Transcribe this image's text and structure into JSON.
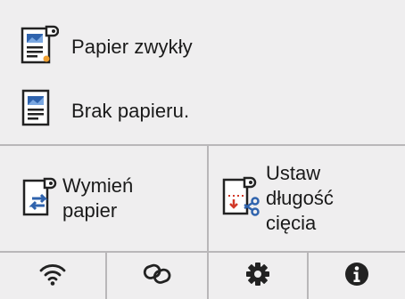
{
  "status": {
    "media_type": "Papier zwykły",
    "paper_status": "Brak papieru."
  },
  "actions": {
    "replace_paper": [
      "Wymień",
      "papier"
    ],
    "set_cut_length": [
      "Ustaw",
      "długość",
      "cięcia"
    ]
  },
  "toolbar": {
    "icons": [
      "wifi-icon",
      "link-icon",
      "gear-icon",
      "info-icon"
    ]
  },
  "colors": {
    "panel": "#efeeef",
    "divider": "#b9b7b9",
    "icon_blue": "#2f63ad",
    "icon_dark": "#222222",
    "accent_red": "#d23a2a",
    "accent_orange": "#f0a030"
  }
}
